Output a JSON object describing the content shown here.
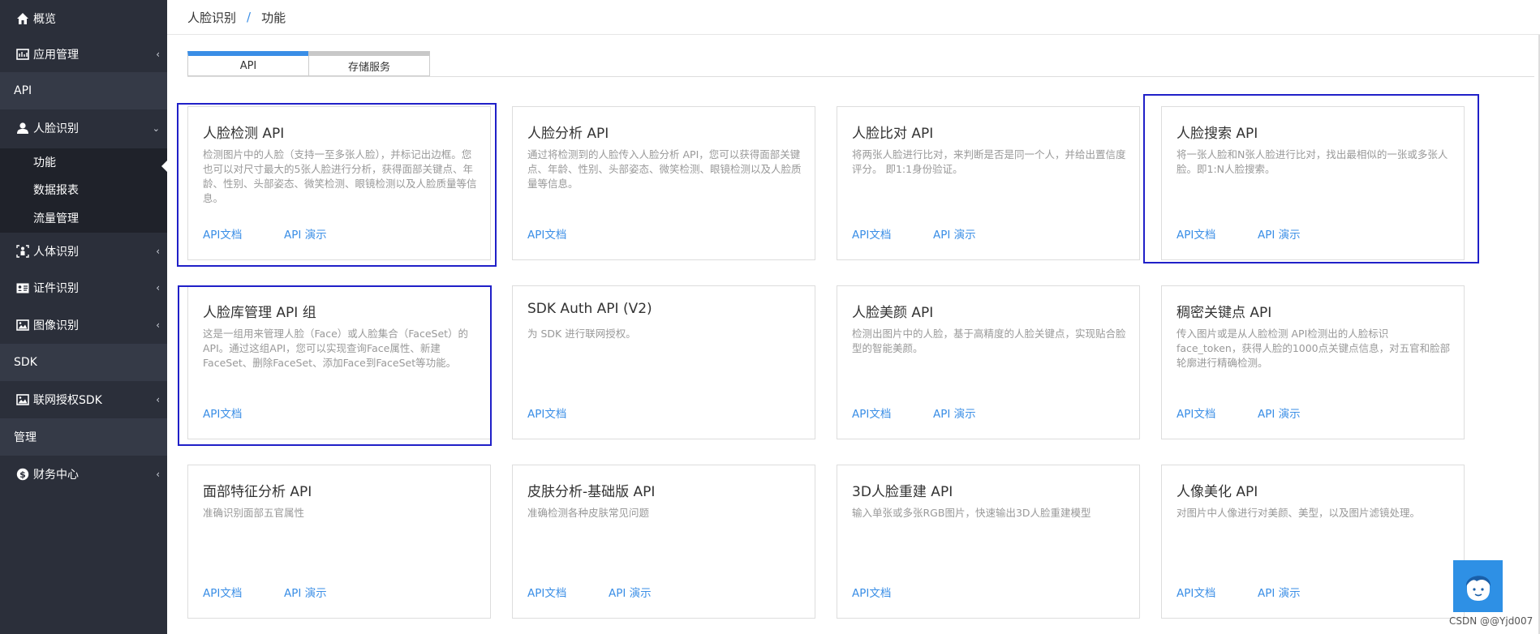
{
  "sidebar": {
    "overview": "概览",
    "app_mgmt": "应用管理",
    "section_api": "API",
    "face_recognition": "人脸识别",
    "sub_items": [
      "功能",
      "数据报表",
      "流量管理"
    ],
    "body_recognition": "人体识别",
    "id_recognition": "证件识别",
    "image_recognition": "图像识别",
    "section_sdk": "SDK",
    "network_sdk": "联网授权SDK",
    "section_manage": "管理",
    "finance": "财务中心"
  },
  "breadcrumb": {
    "root": "人脸识别",
    "separator": "/",
    "current": "功能"
  },
  "tabs": [
    "API",
    "存储服务"
  ],
  "cards": [
    {
      "title": "人脸检测 API",
      "desc": "检测图片中的人脸（支持一至多张人脸），并标记出边框。您也可以对尺寸最大的5张人脸进行分析，获得面部关键点、年龄、性别、头部姿态、微笑检测、眼镜检测以及人脸质量等信息。",
      "doc": "API文档",
      "demo": "API 演示"
    },
    {
      "title": "人脸分析 API",
      "desc": "通过将检测到的人脸传入人脸分析 API，您可以获得面部关键点、年龄、性别、头部姿态、微笑检测、眼镜检测以及人脸质量等信息。",
      "doc": "API文档",
      "demo": ""
    },
    {
      "title": "人脸比对 API",
      "desc": "将两张人脸进行比对，来判断是否是同一个人，并给出置信度评分。 即1:1身份验证。",
      "doc": "API文档",
      "demo": "API 演示"
    },
    {
      "title": "人脸搜索 API",
      "desc": "将一张人脸和N张人脸进行比对，找出最相似的一张或多张人脸。即1:N人脸搜索。",
      "doc": "API文档",
      "demo": "API 演示"
    },
    {
      "title": "人脸库管理 API 组",
      "desc": "这是一组用来管理人脸（Face）或人脸集合（FaceSet）的API。通过这组API，您可以实现查询Face属性、新建FaceSet、删除FaceSet、添加Face到FaceSet等功能。",
      "doc": "API文档",
      "demo": ""
    },
    {
      "title": "SDK Auth API (V2)",
      "desc": "为 SDK 进行联网授权。",
      "doc": "API文档",
      "demo": ""
    },
    {
      "title": "人脸美颜 API",
      "desc": "检测出图片中的人脸，基于高精度的人脸关键点，实现贴合脸型的智能美颜。",
      "doc": "API文档",
      "demo": "API 演示"
    },
    {
      "title": "稠密关键点 API",
      "desc": "传入图片或是从人脸检测 API检测出的人脸标识face_token，获得人脸的1000点关键点信息，对五官和脸部轮廓进行精确检测。",
      "doc": "API文档",
      "demo": "API 演示"
    },
    {
      "title": "面部特征分析 API",
      "desc": "准确识别面部五官属性",
      "doc": "API文档",
      "demo": "API 演示"
    },
    {
      "title": "皮肤分析-基础版 API",
      "desc": "准确检测各种皮肤常见问题",
      "doc": "API文档",
      "demo": "API 演示"
    },
    {
      "title": "3D人脸重建 API",
      "desc": "输入单张或多张RGB图片，快速输出3D人脸重建模型",
      "doc": "API文档",
      "demo": ""
    },
    {
      "title": "人像美化 API",
      "desc": "对图片中人像进行对美颜、美型，以及图片滤镜处理。",
      "doc": "API文档",
      "demo": "API 演示"
    }
  ],
  "watermark": "CSDN @@Yjd007",
  "colors": {
    "sidebar_bg": "#2b2f3a",
    "section_bg": "#353a47",
    "accent": "#3a8ee6",
    "highlight_border": "#2020c8"
  },
  "icons": [
    "home-icon",
    "app-icon",
    "user-icon",
    "body-icon",
    "id-card-icon",
    "image-icon",
    "image-icon",
    "coin-icon",
    "chat-avatar-icon"
  ]
}
